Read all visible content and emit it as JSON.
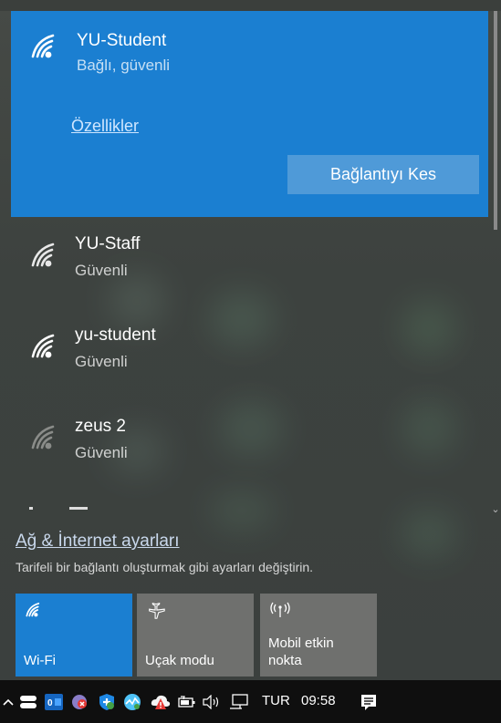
{
  "connected_network": {
    "name": "YU-Student",
    "status": "Bağlı, güvenli",
    "properties_link": "Özellikler",
    "disconnect_button": "Bağlantıyı Kes"
  },
  "networks": [
    {
      "name": "YU-Staff",
      "status": "Güvenli"
    },
    {
      "name": "yu-student",
      "status": "Güvenli"
    },
    {
      "name": "zeus 2",
      "status": "Güvenli"
    }
  ],
  "settings": {
    "link": "Ağ & İnternet ayarları",
    "description": "Tarifeli bir bağlantı oluşturmak gibi ayarları değiştirin."
  },
  "quick_actions": [
    {
      "label": "Wi-Fi",
      "icon": "wifi-icon",
      "active": true
    },
    {
      "label": "Uçak modu",
      "icon": "airplane-icon",
      "active": false
    },
    {
      "label": "Mobil etkin nokta",
      "icon": "hotspot-icon",
      "active": false
    }
  ],
  "taskbar": {
    "language": "TUR",
    "time": "09:58",
    "icons": [
      "chevron-up-icon",
      "storage-icon",
      "outlook-icon",
      "antivirus-icon",
      "shield-icon",
      "monitor-app-icon",
      "cloud-alert-icon",
      "battery-icon",
      "volume-icon",
      "network-icon",
      "notification-icon"
    ]
  },
  "colors": {
    "accent": "#1b7fd1",
    "disconnect": "#4f9ad8",
    "tile_inactive": "#6f706e",
    "taskbar": "#0f0f0f"
  }
}
